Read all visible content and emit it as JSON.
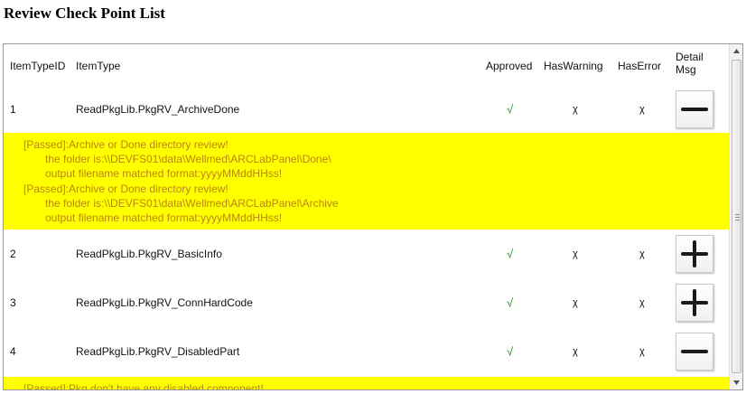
{
  "page": {
    "title": "Review Check Point List"
  },
  "table": {
    "headers": {
      "item_type_id": "ItemTypeID",
      "item_type": "ItemType",
      "approved": "Approved",
      "has_warning": "HasWarning",
      "has_error": "HasError",
      "detail_msg_line1": "Detail",
      "detail_msg_line2": "Msg"
    },
    "rows": [
      {
        "id": "1",
        "type": "ReadPkgLib.PkgRV_ArchiveDone",
        "approved": "√",
        "has_warning": "χ",
        "has_error": "χ",
        "detail_button": "collapse"
      },
      {
        "id": "2",
        "type": "ReadPkgLib.PkgRV_BasicInfo",
        "approved": "√",
        "has_warning": "χ",
        "has_error": "χ",
        "detail_button": "expand"
      },
      {
        "id": "3",
        "type": "ReadPkgLib.PkgRV_ConnHardCode",
        "approved": "√",
        "has_warning": "χ",
        "has_error": "χ",
        "detail_button": "expand"
      },
      {
        "id": "4",
        "type": "ReadPkgLib.PkgRV_DisabledPart",
        "approved": "√",
        "has_warning": "χ",
        "has_error": "χ",
        "detail_button": "collapse"
      }
    ],
    "details": [
      {
        "lines": [
          "[Passed]:Archive or Done directory review!",
          "the folder is:\\\\DEVFS01\\data\\Wellmed\\ARCLabPanel\\Done\\",
          "output filename matched format:yyyyMMddHHss!",
          "[Passed]:Archive or Done directory review!",
          "the folder is:\\\\DEVFS01\\data\\Wellmed\\ARCLabPanel\\Archive",
          "output filename matched format:yyyyMMddHHss!"
        ]
      },
      {
        "lines": [
          "[Passed]:Pkg don't have any disabled component!"
        ]
      }
    ]
  },
  "colors": {
    "detail_bg": "#ffff00",
    "detail_text": "#b8860b",
    "approved": "#1a9a1a"
  },
  "icons": {
    "expand": "plus-icon",
    "collapse": "minus-icon"
  }
}
